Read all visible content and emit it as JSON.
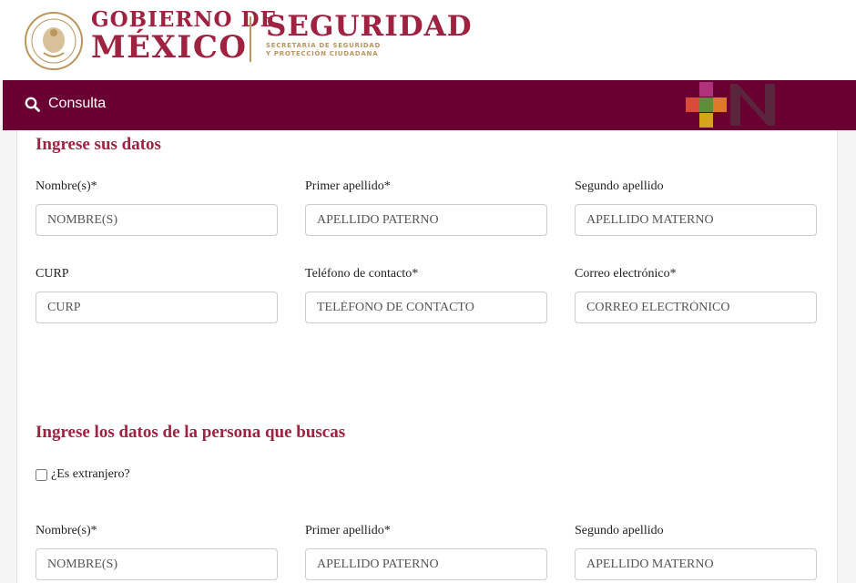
{
  "header": {
    "gobierno_line1": "GOBIERNO DE",
    "gobierno_line2": "MÉXICO",
    "seguridad_title": "SEGURIDAD",
    "seguridad_sub1": "SECRETARÍA DE SEGURIDAD",
    "seguridad_sub2": "Y PROTECCIÓN CIUDADANA"
  },
  "navbar": {
    "search_label": "Consulta",
    "search_icon": "search-icon"
  },
  "section1": {
    "title": "Ingrese sus datos",
    "fields": [
      {
        "label": "Nombre(s)*",
        "placeholder": "NOMBRE(S)"
      },
      {
        "label": "Primer apellido*",
        "placeholder": "APELLIDO PATERNO"
      },
      {
        "label": "Segundo apellido",
        "placeholder": "APELLIDO MATERNO"
      },
      {
        "label": "CURP",
        "placeholder": "CURP"
      },
      {
        "label": "Teléfono de contacto*",
        "placeholder": "TELÉFONO DE CONTACTO"
      },
      {
        "label": "Correo electrónico*",
        "placeholder": "CORREO ELECTRÓNICO"
      }
    ]
  },
  "section2": {
    "title": "Ingrese los datos de la persona que buscas",
    "foreigner_label": "¿Es extranjero?",
    "fields": [
      {
        "label": "Nombre(s)*",
        "placeholder": "NOMBRE(S)"
      },
      {
        "label": "Primer apellido*",
        "placeholder": "APELLIDO PATERNO"
      },
      {
        "label": "Segundo apellido",
        "placeholder": "APELLIDO MATERNO"
      }
    ]
  },
  "colors": {
    "brand_guinda": "#9f2241",
    "navbar": "#6a0032",
    "gold": "#bc955c"
  }
}
